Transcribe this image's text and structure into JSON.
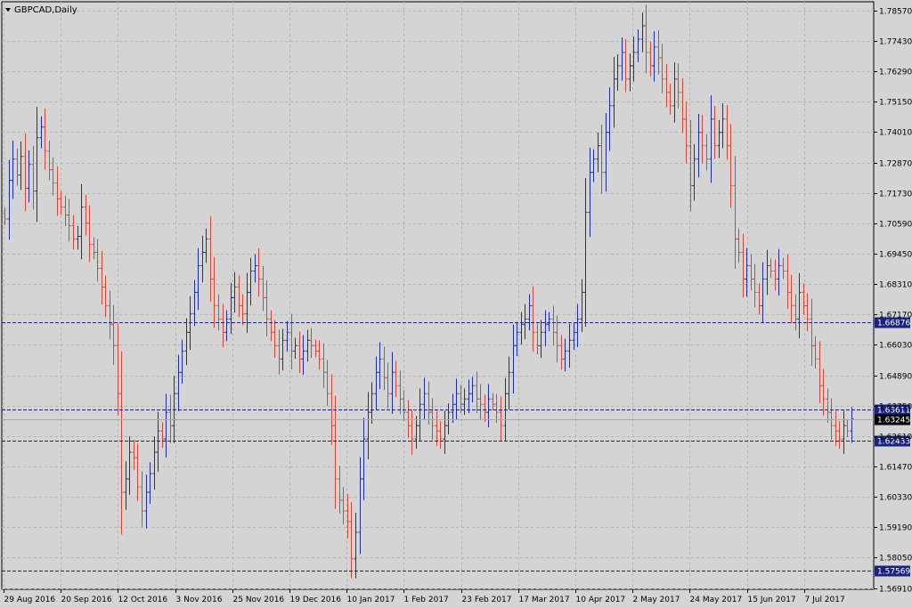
{
  "window": {
    "title": "GBPCAD,Daily"
  },
  "colors": {
    "background": "#d4d4d4",
    "grid": "#b4b4b4",
    "bull": "#1e2f9c",
    "bear": "#d04a3c",
    "level_line": "#1a237e",
    "level_tag_bg": "#1a237e",
    "current_tag_bg": "#000000"
  },
  "chart_data": {
    "type": "ohlc",
    "title": "GBPCAD,Daily",
    "y_axis_position": "right",
    "ylim": [
      1.5686,
      1.789
    ],
    "grid": true,
    "y_ticks": [
      "1.78570",
      "1.77430",
      "1.76290",
      "1.75150",
      "1.74010",
      "1.72870",
      "1.71730",
      "1.70590",
      "1.69450",
      "1.68310",
      "1.67170",
      "1.66030",
      "1.64890",
      "1.63750",
      "1.62610",
      "1.61470",
      "1.60330",
      "1.59190",
      "1.58050",
      "1.56910"
    ],
    "x_labels": [
      "29 Aug 2016",
      "20 Sep 2016",
      "12 Oct 2016",
      "3 Nov 2016",
      "25 Nov 2016",
      "19 Dec 2016",
      "10 Jan 2017",
      "1 Feb 2017",
      "23 Feb 2017",
      "17 Mar 2017",
      "10 Apr 2017",
      "2 May 2017",
      "24 May 2017",
      "15 Jun 2017",
      "7 Jul 2017"
    ],
    "current_price": "1.63245",
    "levels": [
      {
        "value": "1.66876"
      },
      {
        "value": "1.63611"
      },
      {
        "value": "1.62433"
      },
      {
        "value": "1.57569"
      }
    ],
    "closes": [
      1.7075,
      1.722,
      1.73,
      1.724,
      1.731,
      1.719,
      1.728,
      1.718,
      1.738,
      1.742,
      1.733,
      1.726,
      1.721,
      1.715,
      1.712,
      1.709,
      1.705,
      1.7,
      1.701,
      1.712,
      1.706,
      1.698,
      1.695,
      1.689,
      1.682,
      1.675,
      1.668,
      1.66,
      1.642,
      1.605,
      1.61,
      1.62,
      1.618,
      1.607,
      1.598,
      1.605,
      1.612,
      1.62,
      1.628,
      1.625,
      1.635,
      1.63,
      1.642,
      1.65,
      1.658,
      1.665,
      1.672,
      1.68,
      1.69,
      1.695,
      1.7,
      1.685,
      1.675,
      1.67,
      1.665,
      1.67,
      1.678,
      1.682,
      1.675,
      1.672,
      1.68,
      1.688,
      1.69,
      1.685,
      1.678,
      1.67,
      1.665,
      1.66,
      1.655,
      1.662,
      1.665,
      1.658,
      1.66,
      1.655,
      1.658,
      1.662,
      1.66,
      1.658,
      1.655,
      1.65,
      1.642,
      1.63,
      1.61,
      1.602,
      1.598,
      1.594,
      1.58,
      1.59,
      1.61,
      1.625,
      1.635,
      1.642,
      1.65,
      1.655,
      1.648,
      1.642,
      1.65,
      1.645,
      1.64,
      1.635,
      1.63,
      1.625,
      1.63,
      1.638,
      1.642,
      1.635,
      1.63,
      1.628,
      1.625,
      1.63,
      1.635,
      1.638,
      1.642,
      1.638,
      1.64,
      1.642,
      1.645,
      1.64,
      1.638,
      1.635,
      1.64,
      1.638,
      1.635,
      1.63,
      1.642,
      1.65,
      1.66,
      1.665,
      1.668,
      1.67,
      1.675,
      1.665,
      1.66,
      1.665,
      1.668,
      1.67,
      1.665,
      1.66,
      1.655,
      1.658,
      1.662,
      1.665,
      1.67,
      1.68,
      1.71,
      1.725,
      1.73,
      1.735,
      1.725,
      1.74,
      1.75,
      1.76,
      1.765,
      1.77,
      1.76,
      1.765,
      1.77,
      1.775,
      1.78,
      1.77,
      1.765,
      1.772,
      1.768,
      1.76,
      1.755,
      1.75,
      1.76,
      1.755,
      1.745,
      1.735,
      1.72,
      1.73,
      1.74,
      1.735,
      1.73,
      1.745,
      1.735,
      1.74,
      1.745,
      1.735,
      1.72,
      1.7,
      1.695,
      1.685,
      1.69,
      1.685,
      1.68,
      1.675,
      1.685,
      1.69,
      1.688,
      1.685,
      1.69,
      1.688,
      1.68,
      1.675,
      1.67,
      1.68,
      1.675,
      1.67,
      1.66,
      1.655,
      1.645,
      1.64,
      1.635,
      1.63,
      1.628,
      1.625,
      1.63,
      1.628,
      1.6325
    ]
  }
}
